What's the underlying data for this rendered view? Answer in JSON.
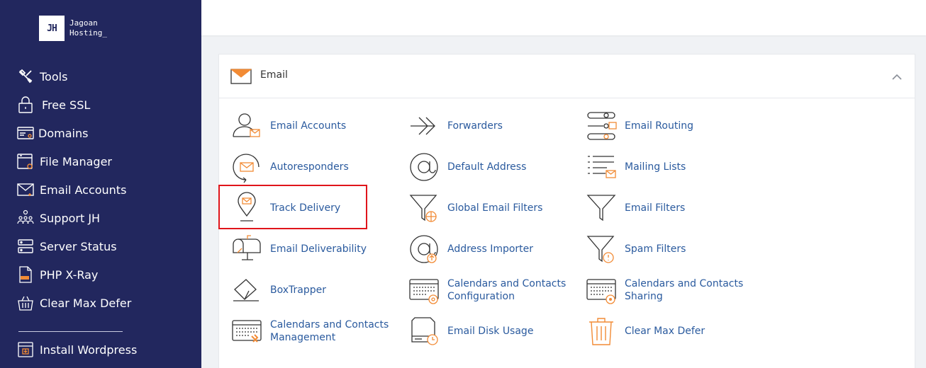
{
  "brand": {
    "mark": "JH",
    "line1": "Jagoan",
    "line2": "Hosting_"
  },
  "sidebar": {
    "items": [
      {
        "label": "Tools",
        "icon": "tools-icon"
      },
      {
        "label": "Free SSL",
        "icon": "lock-icon"
      },
      {
        "label": "Domains",
        "icon": "domain-icon"
      },
      {
        "label": "File Manager",
        "icon": "folder-gear-icon"
      },
      {
        "label": "Email Accounts",
        "icon": "envelope-icon"
      },
      {
        "label": "Support JH",
        "icon": "people-icon"
      },
      {
        "label": "Server Status",
        "icon": "server-icon"
      },
      {
        "label": "PHP X-Ray",
        "icon": "php-file-icon"
      },
      {
        "label": "Clear Max Defer",
        "icon": "basket-icon"
      }
    ],
    "bottom": {
      "label": "Install Wordpress",
      "icon": "install-icon"
    }
  },
  "section": {
    "title": "Email",
    "icon": "envelope-icon",
    "collapse_icon": "chevron-up-icon",
    "items": [
      [
        "Email Accounts",
        "Forwarders",
        "Email Routing"
      ],
      [
        "Autoresponders",
        "Default Address",
        "Mailing Lists"
      ],
      [
        "Track Delivery",
        "Global Email Filters",
        "Email Filters"
      ],
      [
        "Email Deliverability",
        "Address Importer",
        "Spam Filters"
      ],
      [
        "BoxTrapper",
        "Calendars and Contacts Configuration",
        "Calendars and Contacts Sharing"
      ],
      [
        "Calendars and Contacts Management",
        "Email Disk Usage",
        "Clear Max Defer"
      ]
    ]
  },
  "highlighted_item": "Track Delivery",
  "colors": {
    "sidebar": "#22275e",
    "link": "#2a5a9e",
    "accent": "#f28b35",
    "highlight": "#e0151b"
  }
}
